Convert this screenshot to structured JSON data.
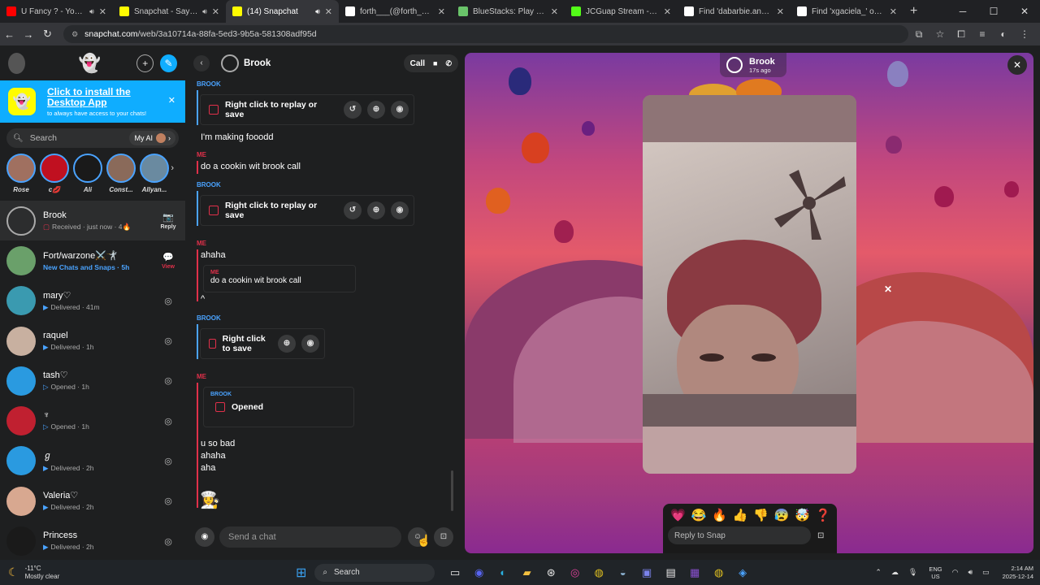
{
  "browser": {
    "tabs": [
      {
        "title": "U Fancy ? - YouTube",
        "color": "#ff0000",
        "muted": true,
        "active": false
      },
      {
        "title": "Snapchat - Say It In A Snap",
        "color": "#fffc00",
        "muted": true,
        "active": false
      },
      {
        "title": "(14) Snapchat",
        "color": "#fffc00",
        "muted": true,
        "active": true
      },
      {
        "title": "forth___(@forth___) is L",
        "color": "#ffffff",
        "muted": false,
        "active": false
      },
      {
        "title": "BlueStacks: Play Games or",
        "color": "#6ac46a",
        "muted": false,
        "active": false
      },
      {
        "title": "JCGuap Stream - Watch L",
        "color": "#53fc18",
        "muted": false,
        "active": false
      },
      {
        "title": "Find 'dabarbie.angle' on T",
        "color": "#ffffff",
        "muted": false,
        "active": false
      },
      {
        "title": "Find 'xgaciela_' on TikTok",
        "color": "#ffffff",
        "muted": false,
        "active": false
      }
    ],
    "url_host": "snapchat.com",
    "url_path": "/web/3a10714a-88fa-5ed3-9b5a-581308adf95d"
  },
  "left": {
    "install_title": "Click to install the Desktop App",
    "install_sub": "to always have access to your chats!",
    "search_placeholder": "Search",
    "myai_label": "My AI",
    "stories": [
      {
        "label": "Rose",
        "color": "#a07060"
      },
      {
        "label": "c💋",
        "color": "#c01020"
      },
      {
        "label": "Ali",
        "color": "#1a1a1a"
      },
      {
        "label": "Const...",
        "color": "#8a6a5a"
      },
      {
        "label": "Allyan...",
        "color": "#6a8aa0"
      }
    ],
    "conversations": [
      {
        "name": "Brook",
        "status": "Received · just now · 4🔥",
        "status_type": "received",
        "right_icon": "📷",
        "right_label": "Reply",
        "active": true,
        "color": "#2c2d2e"
      },
      {
        "name": "Fort/warzone⚔️🤺",
        "status": "New Chats and Snaps · 5h",
        "status_type": "new",
        "right_icon": "💬",
        "right_label": "View",
        "active": false,
        "color": "#6aa06a"
      },
      {
        "name": "mary♡",
        "status": "Delivered · 41m",
        "status_type": "delivered",
        "right_icon": "◎",
        "right_label": "",
        "active": false,
        "color": "#3a9ab0"
      },
      {
        "name": "raquel",
        "status": "Delivered · 1h",
        "status_type": "delivered",
        "right_icon": "◎",
        "right_label": "",
        "active": false,
        "color": "#c8b0a0"
      },
      {
        "name": "tash♡",
        "status": "Opened · 1h",
        "status_type": "opened",
        "right_icon": "◎",
        "right_label": "",
        "active": false,
        "color": "#2a9ae0"
      },
      {
        "name": "♆",
        "status": "Opened · 1h",
        "status_type": "opened",
        "right_icon": "◎",
        "right_label": "",
        "active": false,
        "color": "#c02030"
      },
      {
        "name": "ℊ",
        "status": "Delivered · 2h",
        "status_type": "delivered",
        "right_icon": "◎",
        "right_label": "",
        "active": false,
        "color": "#2a9ae0"
      },
      {
        "name": "Valeria♡",
        "status": "Delivered · 2h",
        "status_type": "delivered",
        "right_icon": "◎",
        "right_label": "",
        "active": false,
        "color": "#d8a890"
      },
      {
        "name": "Princess",
        "status": "Delivered · 2h",
        "status_type": "delivered",
        "right_icon": "◎",
        "right_label": "",
        "active": false,
        "color": "#1a1a1a"
      }
    ]
  },
  "chat": {
    "name": "Brook",
    "call_label": "Call",
    "label_brook": "BROOK",
    "label_me": "ME",
    "snap_replay": "Right click to replay or save",
    "snap_save": "Right click to save",
    "msg1": "I'm making fooodd",
    "msg2": "do a cookin wit brook call",
    "msg3": "ahaha",
    "quote_text": "do a cookin wit brook call",
    "caret": "^",
    "opened_label": "Opened",
    "msg4": "u so bad",
    "msg5": "ahaha",
    "msg6": "aha",
    "input_placeholder": "Send a chat"
  },
  "viewer": {
    "name": "Brook",
    "time": "17s ago",
    "reactions": [
      "💗",
      "😂",
      "🔥",
      "👍",
      "👎",
      "😰",
      "🤯",
      "❓"
    ],
    "reply_placeholder": "Reply to Snap"
  },
  "taskbar": {
    "temp": "-11°C",
    "weather": "Mostly clear",
    "search": "Search",
    "lang1": "ENG",
    "lang2": "US",
    "time": "2:14 AM",
    "date": "2025-12-14"
  }
}
